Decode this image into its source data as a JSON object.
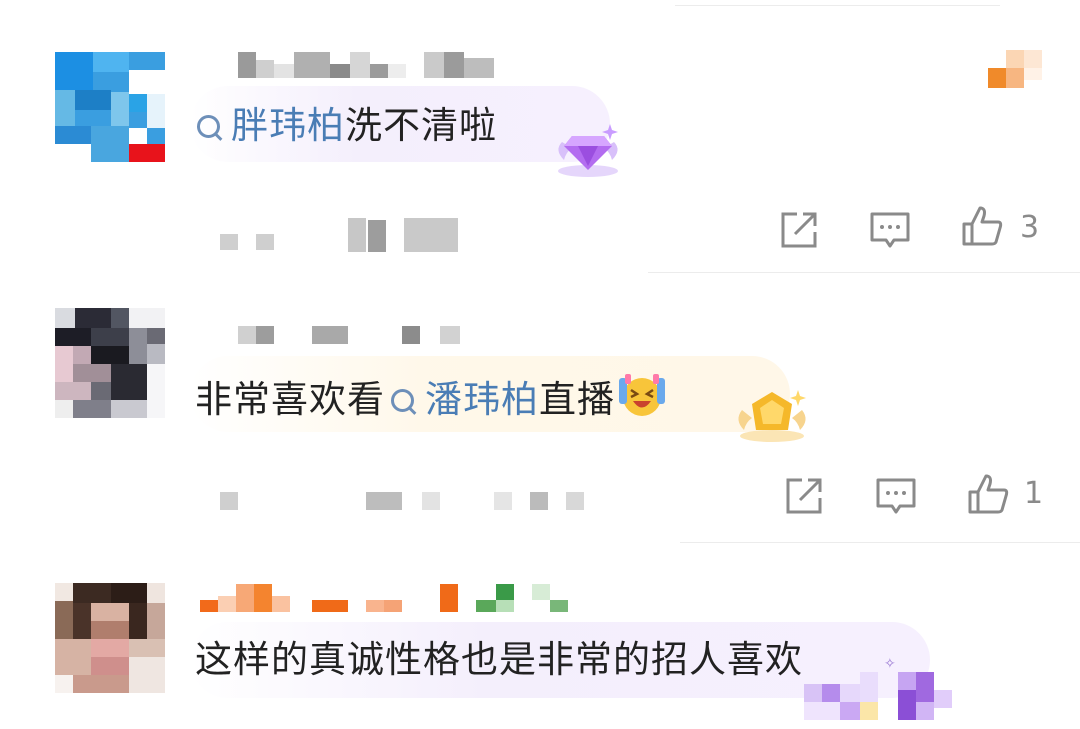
{
  "comments": [
    {
      "mention": "胖玮柏",
      "text_after": "洗不清啦",
      "like_count": "3",
      "badge": "purple-diamond-badge"
    },
    {
      "text_before": "非常喜欢看",
      "mention": "潘玮柏",
      "text_after": "直播",
      "emoji": "laughing-crying-emoji",
      "like_count": "1",
      "badge": "gold-badge"
    },
    {
      "text": "这样的真诚性格也是非常的招人喜欢",
      "badge": "purple-pixel-badge"
    }
  ],
  "icons": {
    "share": "share-icon",
    "reply": "comment-icon",
    "like": "thumbs-up-icon"
  },
  "colors": {
    "mention": "#4a7db5",
    "icon_gray": "#8a8a8a",
    "orange": "#f08a2a",
    "purple": "#a873e0"
  }
}
